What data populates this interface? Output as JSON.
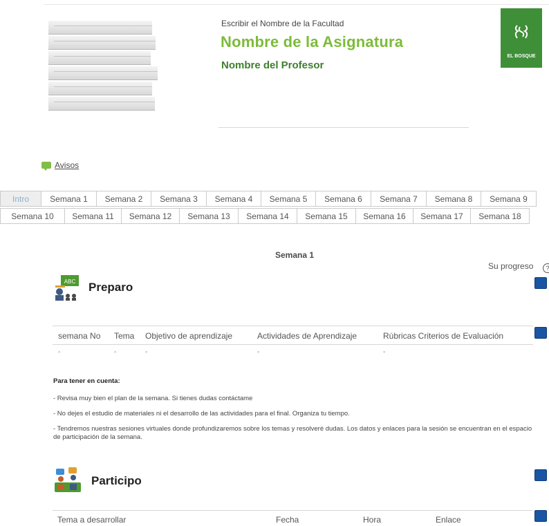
{
  "header": {
    "faculty": "Escribir el Nombre de la Facultad",
    "subject": "Nombre de la Asignatura",
    "professor": "Nombre del Profesor",
    "logo_text": "EL BOSQUE",
    "logo_color": "#3f8f38"
  },
  "notices": {
    "icon": "chat-bubble-icon",
    "label": "Avisos"
  },
  "tabs": {
    "row1": [
      "Intro",
      "Semana 1",
      "Semana 2",
      "Semana 3",
      "Semana 4",
      "Semana 5",
      "Semana 6",
      "Semana 7",
      "Semana 8",
      "Semana 9"
    ],
    "row2": [
      "Semana 10",
      "Semana 11",
      "Semana 12",
      "Semana 13",
      "Semana 14",
      "Semana 15",
      "Semana 16",
      "Semana 17",
      "Semana 18"
    ],
    "active": "Intro"
  },
  "week": {
    "title": "Semana 1",
    "progress_label": "Su progreso"
  },
  "preparo": {
    "title": "Preparo",
    "columns": [
      "semana No",
      "Tema",
      "Objetivo de aprendizaje",
      "Actividades de Aprendizaje",
      "Rúbricas Criterios de Evaluación"
    ],
    "empty_marks": [
      "-",
      "-",
      "-",
      "-",
      "-"
    ]
  },
  "notes": {
    "title": "Para tener en cuenta:",
    "items": [
      "- Revisa muy bien el plan de la semana. Si tienes dudas contáctame",
      "- No dejes el estudio de materiales ni el desarrollo de las actividades para el final. Organiza tu tiempo.",
      "- Tendremos nuestras sesiones virtuales donde profundizaremos sobre los temas y resolveré dudas. Los datos y enlaces para la sesión se encuentran en el espacio de participación de la semana."
    ]
  },
  "participo": {
    "title": "Participo",
    "columns": [
      "Tema a desarrollar",
      "Fecha",
      "Hora",
      "Enlace"
    ]
  },
  "colors": {
    "subject": "#7cbb3a",
    "professor": "#3d7f2d",
    "checkbox": "#1a55a3",
    "active_tab_text": "#8db1cb"
  }
}
